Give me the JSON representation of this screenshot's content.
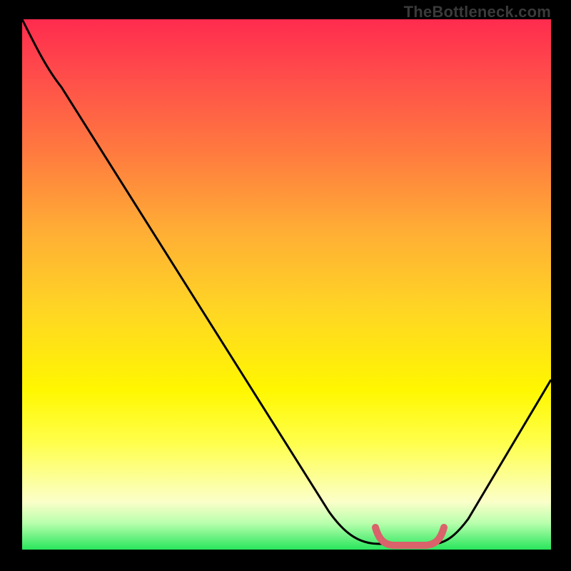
{
  "watermark": "TheBottleneck.com",
  "chart_data": {
    "type": "line",
    "title": "",
    "xlabel": "",
    "ylabel": "",
    "xlim": [
      0,
      100
    ],
    "ylim": [
      0,
      100
    ],
    "series": [
      {
        "name": "bottleneck-curve",
        "x": [
          0,
          4,
          10,
          20,
          30,
          40,
          50,
          60,
          65,
          68,
          72,
          78,
          80,
          82,
          90,
          100
        ],
        "values": [
          100,
          96,
          89,
          76,
          62,
          48,
          34,
          19,
          10,
          4,
          1,
          1,
          3,
          5,
          17,
          32
        ]
      },
      {
        "name": "optimal-range-marker",
        "x": [
          68,
          70,
          73,
          76,
          78
        ],
        "values": [
          4,
          1.5,
          1,
          1.5,
          4
        ]
      }
    ],
    "gradient_stops": [
      {
        "pos": 0,
        "color": "#ff2b4e"
      },
      {
        "pos": 10,
        "color": "#ff4b4b"
      },
      {
        "pos": 25,
        "color": "#ff7a3f"
      },
      {
        "pos": 40,
        "color": "#ffae35"
      },
      {
        "pos": 55,
        "color": "#ffd624"
      },
      {
        "pos": 70,
        "color": "#fff700"
      },
      {
        "pos": 80,
        "color": "#ffff4d"
      },
      {
        "pos": 91,
        "color": "#fbffc9"
      },
      {
        "pos": 95,
        "color": "#b9ffad"
      },
      {
        "pos": 100,
        "color": "#28e65c"
      }
    ],
    "marker_color": "#d9626b",
    "curve_color": "#000000"
  }
}
